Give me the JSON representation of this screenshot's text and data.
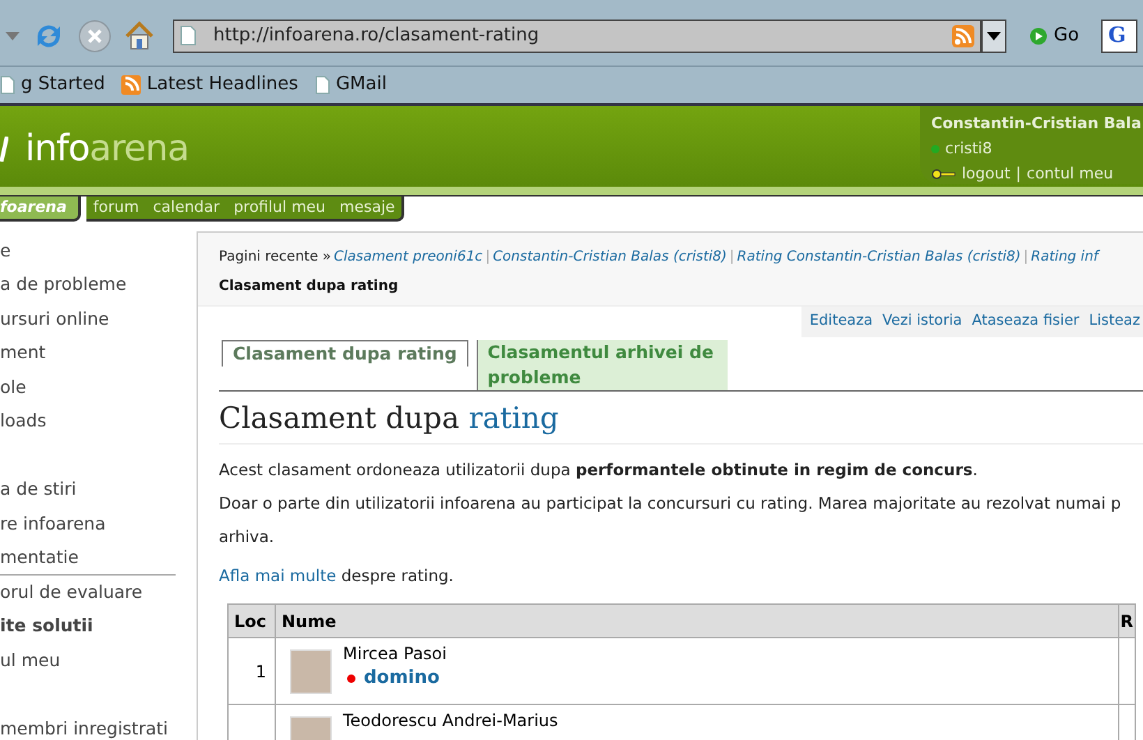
{
  "browser": {
    "url": "http://infoarena.ro/clasament-rating",
    "go_label": "Go",
    "search_logo": "G",
    "bookmarks": [
      {
        "kind": "page",
        "label": "g Started"
      },
      {
        "kind": "feed",
        "label": "Latest Headlines"
      },
      {
        "kind": "page",
        "label": "GMail"
      }
    ]
  },
  "header": {
    "logo_light": "info",
    "logo_dim": "arena",
    "user": {
      "full_name": "Constantin-Cristian Bala",
      "username": "cristi8",
      "color": "#22aa22",
      "logout": "logout",
      "separator": "|",
      "account": "contul meu"
    }
  },
  "nav": [
    {
      "label": "foarena",
      "selected": true
    },
    {
      "label": "forum",
      "selected": false
    },
    {
      "label": "calendar",
      "selected": false
    },
    {
      "label": "profilul meu",
      "selected": false
    },
    {
      "label": "mesaje",
      "selected": false
    }
  ],
  "sidebar": {
    "items": [
      {
        "kind": "link",
        "label": "e",
        "bold": false,
        "divider_after": false
      },
      {
        "kind": "link",
        "label": "a de probleme",
        "bold": false,
        "divider_after": false
      },
      {
        "kind": "link",
        "label": "ursuri online",
        "bold": false,
        "divider_after": false
      },
      {
        "kind": "link",
        "label": "ment",
        "bold": false,
        "divider_after": false
      },
      {
        "kind": "link",
        "label": "ole",
        "bold": false,
        "divider_after": false
      },
      {
        "kind": "link",
        "label": "loads",
        "bold": false,
        "divider_after": false
      },
      {
        "kind": "spacer"
      },
      {
        "kind": "link",
        "label": "a de stiri",
        "bold": false,
        "divider_after": false
      },
      {
        "kind": "link",
        "label": "re infoarena",
        "bold": false,
        "divider_after": false
      },
      {
        "kind": "link",
        "label": "mentatie",
        "bold": false,
        "divider_after": true
      },
      {
        "kind": "link",
        "label": "orul de evaluare",
        "bold": false,
        "divider_after": false
      },
      {
        "kind": "link",
        "label": "ite solutii",
        "bold": true,
        "divider_after": false
      },
      {
        "kind": "link",
        "label": "ul meu",
        "bold": false,
        "divider_after": false
      },
      {
        "kind": "spacer"
      },
      {
        "kind": "link",
        "label": "membri inregistrati",
        "bold": false,
        "divider_after": false
      }
    ]
  },
  "breadcrumb": {
    "prefix": "Pagini recente »",
    "separator": "|",
    "links": [
      "Clasament preoni61c",
      "Constantin-Cristian Balas (cristi8)",
      "Rating Constantin-Cristian Balas (cristi8)",
      "Rating inf"
    ],
    "current": "Clasament dupa rating"
  },
  "actions": [
    "Editeaza",
    "Vezi istoria",
    "Ataseaza fisier",
    "Listeaz"
  ],
  "tabs": [
    {
      "label": "Clasament dupa rating",
      "selected": true
    },
    {
      "label": "Clasamentul arhivei de probleme",
      "selected": false
    }
  ],
  "page": {
    "title": "Clasament dupa",
    "title_link": "rating",
    "paragraphs": [
      "Acest clasament ordoneaza utilizatorii dupa **performantele obtinute in regim de concurs**.",
      "Doar o parte din utilizatorii infoarena au participat la concursuri cu rating. Marea majoritate au rezolvat numai p arhiva."
    ],
    "more_link": "Afla mai multe",
    "more_text": "despre rating."
  },
  "table": {
    "columns": [
      "Loc",
      "Nume",
      "R"
    ],
    "rows": [
      {
        "rank": "1",
        "name": "Mircea Pasoi",
        "handle": "domino",
        "color": "#ee0000"
      },
      {
        "name": "Teodorescu Andrei-Marius"
      }
    ]
  }
}
